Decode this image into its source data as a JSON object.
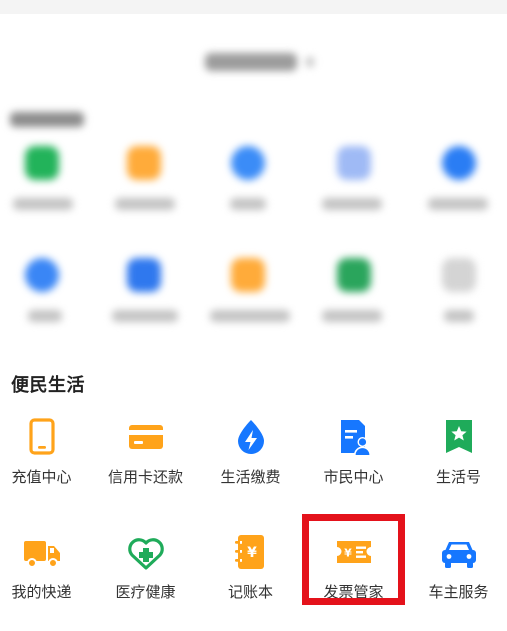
{
  "section": {
    "title": "便民生活"
  },
  "apps": [
    {
      "label": "充值中心",
      "icon": "tablet-icon"
    },
    {
      "label": "信用卡还款",
      "icon": "credit-card-icon"
    },
    {
      "label": "生活缴费",
      "icon": "water-drop-bolt-icon"
    },
    {
      "label": "市民中心",
      "icon": "citizen-document-icon"
    },
    {
      "label": "生活号",
      "icon": "bookmark-star-icon"
    },
    {
      "label": "我的快递",
      "icon": "delivery-truck-icon"
    },
    {
      "label": "医疗健康",
      "icon": "heart-cross-icon"
    },
    {
      "label": "记账本",
      "icon": "ledger-book-icon"
    },
    {
      "label": "发票管家",
      "icon": "invoice-ticket-icon"
    },
    {
      "label": "车主服务",
      "icon": "car-icon"
    }
  ],
  "highlighted_item": "发票管家",
  "colors": {
    "orange": "#ffa31a",
    "blue": "#1677ff",
    "green": "#1fab5a",
    "highlight_red": "#e4121b"
  }
}
